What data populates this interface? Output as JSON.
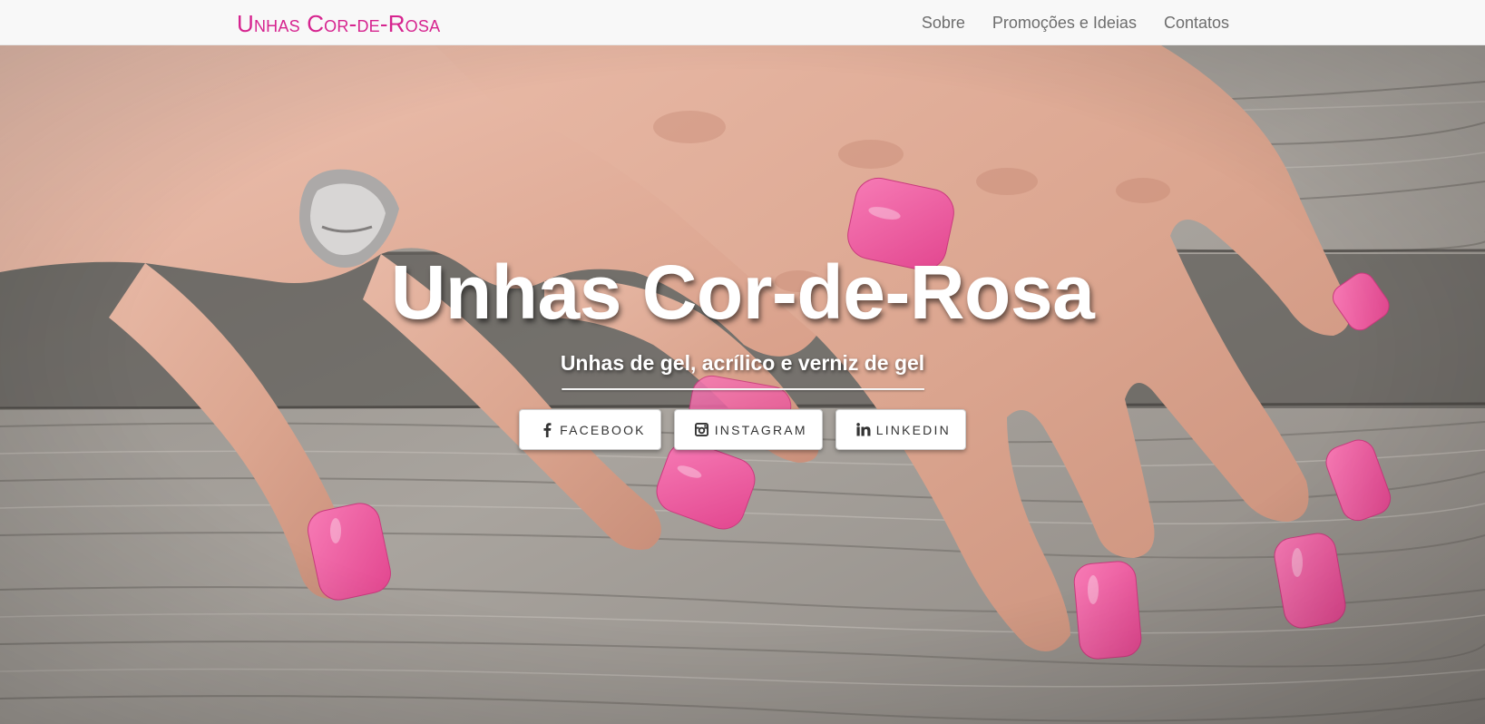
{
  "navbar": {
    "brand": "Unhas Cor-de-Rosa",
    "links": [
      {
        "label": "Sobre"
      },
      {
        "label": "Promoções e Ideias"
      },
      {
        "label": "Contatos"
      }
    ]
  },
  "hero": {
    "title": "Unhas Cor-de-Rosa",
    "subtitle": "Unhas de gel, acrílico e verniz de gel",
    "background_image": "hands-with-pink-nail-polish-on-wooden-planks"
  },
  "social": [
    {
      "label": "FACEBOOK",
      "icon": "facebook-icon"
    },
    {
      "label": "INSTAGRAM",
      "icon": "instagram-icon"
    },
    {
      "label": "LINKEDIN",
      "icon": "linkedin-icon"
    }
  ],
  "colors": {
    "brand": "#d6248f",
    "nav_text": "#6d6d6d",
    "navbar_bg": "#f8f8f8",
    "nail_pink": "#f0589f"
  }
}
